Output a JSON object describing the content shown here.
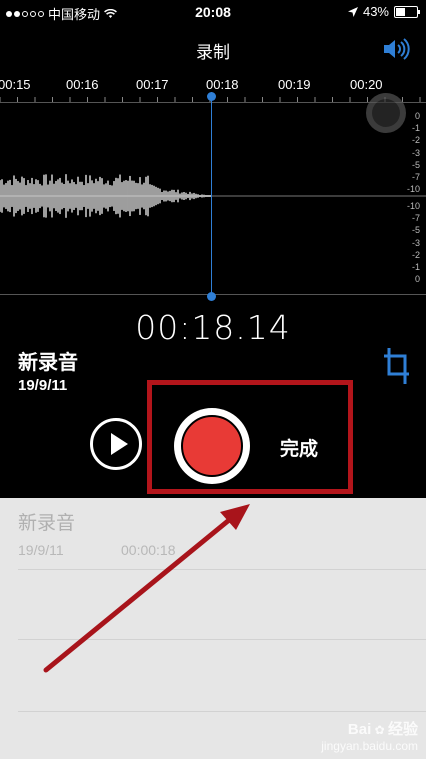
{
  "status": {
    "carrier": "中国移动",
    "time": "20:08",
    "battery": "43%"
  },
  "header": {
    "title": "录制"
  },
  "timeline": {
    "labels": [
      "00:15",
      "00:16",
      "00:17",
      "00:18",
      "00:19",
      "00:20"
    ]
  },
  "db_scale": {
    "top": [
      "0",
      "-1",
      "-2",
      "-3",
      "-5",
      "-7",
      "-10"
    ],
    "bottom": [
      "-10",
      "-7",
      "-5",
      "-3",
      "-2",
      "-1",
      "0"
    ]
  },
  "recording": {
    "timer": "00:18.14",
    "name": "新录音",
    "date": "19/9/11",
    "done_label": "完成"
  },
  "list": {
    "name": "新录音",
    "date": "19/9/11",
    "duration": "00:00:18"
  },
  "colors": {
    "accent": "#2f7fd6",
    "record": "#e83a36",
    "highlight": "#b3151b",
    "arrow": "#a8141b"
  },
  "watermark": {
    "line1": "Bai",
    "line2": "经验",
    "line3": "jingyan.baidu.com"
  }
}
